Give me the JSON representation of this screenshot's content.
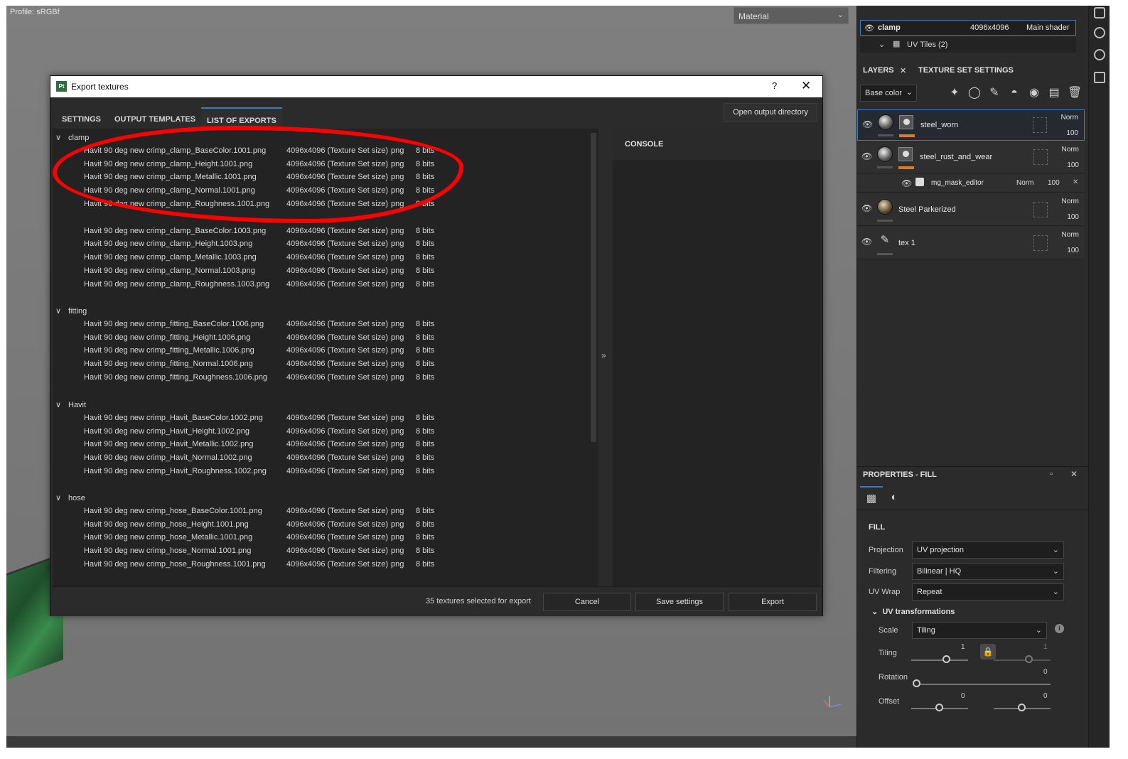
{
  "viewport": {
    "profile": "Profile: sRGBf",
    "material_select": "Material"
  },
  "texture_set": {
    "name": "clamp",
    "resolution": "4096x4096",
    "shader": "Main shader",
    "uv_tiles": "UV Tiles (2)"
  },
  "right_tabs": {
    "layers": "LAYERS",
    "texture_set_settings": "TEXTURE SET SETTINGS"
  },
  "layer_channel": "Base color",
  "layers": [
    {
      "name": "steel_worn",
      "blend": "Norm",
      "opacity": "100"
    },
    {
      "name": "steel_rust_and_wear",
      "blend": "Norm",
      "opacity": "100"
    },
    {
      "name": "mg_mask_editor",
      "blend": "Norm",
      "opacity": "100"
    },
    {
      "name": "Steel Parkerized",
      "blend": "Norm",
      "opacity": "100"
    },
    {
      "name": "tex 1",
      "blend": "Norm",
      "opacity": "100"
    }
  ],
  "properties": {
    "title": "PROPERTIES - FILL",
    "section": "FILL",
    "projection_label": "Projection",
    "projection_value": "UV projection",
    "filtering_label": "Filtering",
    "filtering_value": "Bilinear | HQ",
    "uvwrap_label": "UV Wrap",
    "uvwrap_value": "Repeat",
    "uvt_title": "UV transformations",
    "scale_label": "Scale",
    "scale_value": "Tiling",
    "tiling_label": "Tiling",
    "tiling_value_1": "1",
    "tiling_value_2": "1",
    "rotation_label": "Rotation",
    "rotation_value": "0",
    "offset_label": "Offset",
    "offset_value_1": "0",
    "offset_value_2": "0"
  },
  "dialog": {
    "title": "Export textures",
    "help": "?",
    "tabs": [
      "SETTINGS",
      "OUTPUT TEMPLATES",
      "LIST OF EXPORTS"
    ],
    "open_output": "Open output directory",
    "console_title": "CONSOLE",
    "count_text": "35 textures selected for export",
    "cancel": "Cancel",
    "save_settings": "Save settings",
    "export": "Export",
    "size_text": "4096x4096 (Texture Set size)",
    "format": "png",
    "bits": "8 bits",
    "groups": [
      {
        "name": "clamp",
        "files": [
          "Havit 90 deg new crimp_clamp_BaseColor.1001.png",
          "Havit 90 deg new crimp_clamp_Height.1001.png",
          "Havit 90 deg new crimp_clamp_Metallic.1001.png",
          "Havit 90 deg new crimp_clamp_Normal.1001.png",
          "Havit 90 deg new crimp_clamp_Roughness.1001.png",
          "Havit 90 deg new crimp_clamp_BaseColor.1003.png",
          "Havit 90 deg new crimp_clamp_Height.1003.png",
          "Havit 90 deg new crimp_clamp_Metallic.1003.png",
          "Havit 90 deg new crimp_clamp_Normal.1003.png",
          "Havit 90 deg new crimp_clamp_Roughness.1003.png"
        ]
      },
      {
        "name": "fitting",
        "files": [
          "Havit 90 deg new crimp_fitting_BaseColor.1006.png",
          "Havit 90 deg new crimp_fitting_Height.1006.png",
          "Havit 90 deg new crimp_fitting_Metallic.1006.png",
          "Havit 90 deg new crimp_fitting_Normal.1006.png",
          "Havit 90 deg new crimp_fitting_Roughness.1006.png"
        ]
      },
      {
        "name": "Havit",
        "files": [
          "Havit 90 deg new crimp_Havit_BaseColor.1002.png",
          "Havit 90 deg new crimp_Havit_Height.1002.png",
          "Havit 90 deg new crimp_Havit_Metallic.1002.png",
          "Havit 90 deg new crimp_Havit_Normal.1002.png",
          "Havit 90 deg new crimp_Havit_Roughness.1002.png"
        ]
      },
      {
        "name": "hose",
        "files": [
          "Havit 90 deg new crimp_hose_BaseColor.1001.png",
          "Havit 90 deg new crimp_hose_Height.1001.png",
          "Havit 90 deg new crimp_hose_Metallic.1001.png",
          "Havit 90 deg new crimp_hose_Normal.1001.png",
          "Havit 90 deg new crimp_hose_Roughness.1001.png"
        ]
      }
    ]
  },
  "colors": {
    "accent": "#3d7ac0",
    "highlight": "#ff0000",
    "layer_marker": "#e07a1f"
  }
}
